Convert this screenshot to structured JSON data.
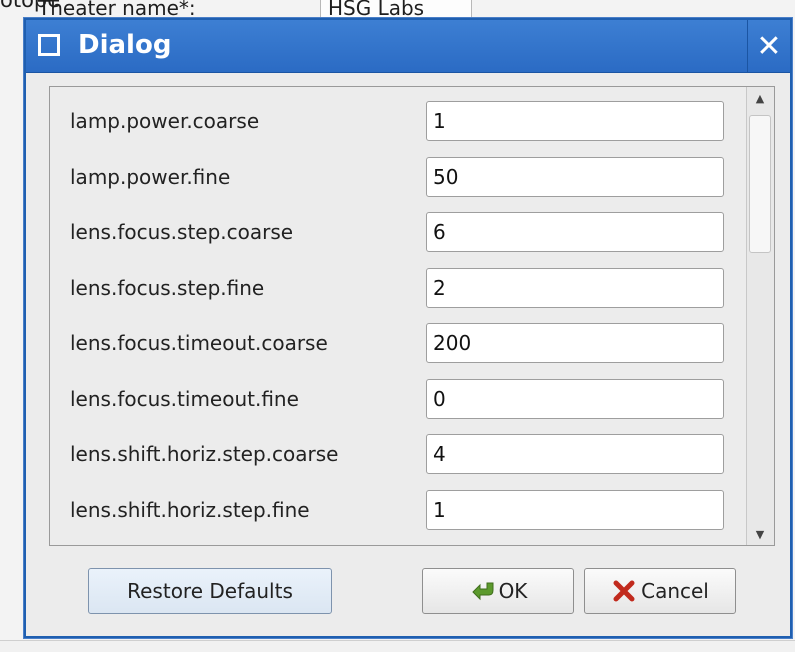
{
  "background": {
    "top_label": "Theater name*:",
    "top_value": "HSG Labs",
    "top_partial": "otope"
  },
  "dialog": {
    "title": "Dialog",
    "close_glyph": "✕",
    "rows": [
      {
        "label": "lamp.power.coarse",
        "value": "1"
      },
      {
        "label": "lamp.power.fine",
        "value": "50"
      },
      {
        "label": "lens.focus.step.coarse",
        "value": "6"
      },
      {
        "label": "lens.focus.step.fine",
        "value": "2"
      },
      {
        "label": "lens.focus.timeout.coarse",
        "value": "200"
      },
      {
        "label": "lens.focus.timeout.fine",
        "value": "0"
      },
      {
        "label": "lens.shift.horiz.step.coarse",
        "value": "4"
      },
      {
        "label": "lens.shift.horiz.step.fine",
        "value": "1"
      }
    ],
    "buttons": {
      "restore": "Restore Defaults",
      "ok": "OK",
      "cancel": "Cancel"
    },
    "icons": {
      "ok": "ok-arrow-icon",
      "cancel": "cancel-x-icon",
      "title": "window-icon"
    }
  },
  "colors": {
    "titlebar": "#2b6bc4",
    "ok_icon": "#5c9a2d",
    "cancel_icon": "#c12a1d"
  }
}
